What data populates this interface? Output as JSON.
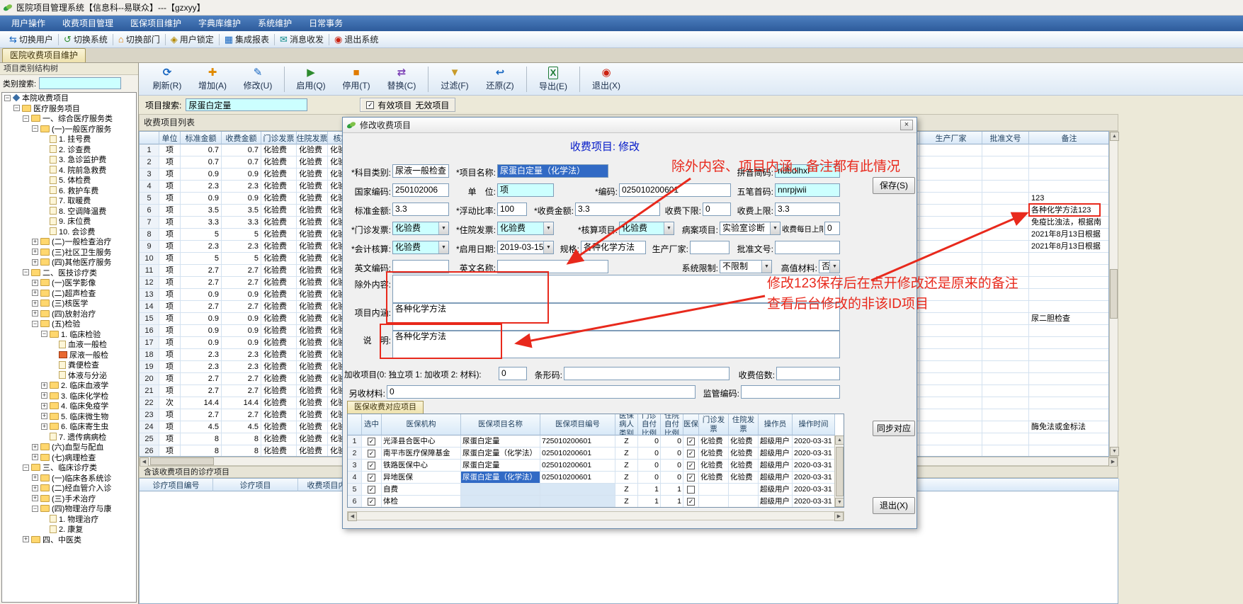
{
  "titlebar": {
    "title": "医院项目管理系统【信息科--易联众】---【gzxyy】"
  },
  "menubar": {
    "items": [
      "用户操作",
      "收费项目管理",
      "医保项目维护",
      "字典库维护",
      "系统维护",
      "日常事务"
    ]
  },
  "quickbar": {
    "items": [
      {
        "name": "switch-user",
        "label": "切换用户",
        "glyph": "⇆",
        "color": "#1565c0"
      },
      {
        "name": "switch-system",
        "label": "切换系统",
        "glyph": "↺",
        "color": "#2e8b2e"
      },
      {
        "name": "switch-dept",
        "label": "切换部门",
        "glyph": "⌂",
        "color": "#e07b00"
      },
      {
        "name": "user-lock",
        "label": "用户锁定",
        "glyph": "◈",
        "color": "#b58900"
      },
      {
        "name": "reports",
        "label": "集成报表",
        "glyph": "▦",
        "color": "#1565c0"
      },
      {
        "name": "messages",
        "label": "消息收发",
        "glyph": "✉",
        "color": "#0e8a8a"
      },
      {
        "name": "exit-system",
        "label": "退出系统",
        "glyph": "◉",
        "color": "#cc2211"
      }
    ]
  },
  "tab_strip": {
    "active_tab": "医院收费项目维护"
  },
  "left_panel": {
    "title": "项目类别结构树",
    "search_label": "类别搜索:",
    "search_value": "",
    "tree": [
      {
        "t": "本院收费项目",
        "i": 0,
        "y": "r",
        "e": "m"
      },
      {
        "t": "医疗服务项目",
        "i": 1,
        "y": "b",
        "e": "m"
      },
      {
        "t": "一、综合医疗服务类",
        "i": 2,
        "y": "b",
        "e": "m"
      },
      {
        "t": "(一)一般医疗服务",
        "i": 3,
        "y": "b",
        "e": "m"
      },
      {
        "t": "1. 挂号费",
        "i": 4,
        "y": "l",
        "e": "n"
      },
      {
        "t": "2. 诊查费",
        "i": 4,
        "y": "l",
        "e": "n"
      },
      {
        "t": "3. 急诊监护费",
        "i": 4,
        "y": "l",
        "e": "n"
      },
      {
        "t": "4. 院前急救费",
        "i": 4,
        "y": "l",
        "e": "n"
      },
      {
        "t": "5. 体检费",
        "i": 4,
        "y": "l",
        "e": "n"
      },
      {
        "t": "6. 救护车费",
        "i": 4,
        "y": "l",
        "e": "n"
      },
      {
        "t": "7. 取暖费",
        "i": 4,
        "y": "l",
        "e": "n"
      },
      {
        "t": "8. 空调降温费",
        "i": 4,
        "y": "l",
        "e": "n"
      },
      {
        "t": "9. 床位费",
        "i": 4,
        "y": "l",
        "e": "n"
      },
      {
        "t": "10. 会诊费",
        "i": 4,
        "y": "l",
        "e": "n"
      },
      {
        "t": "(二)一般检查治疗",
        "i": 3,
        "y": "b",
        "e": "p"
      },
      {
        "t": "(三)社区卫生服务",
        "i": 3,
        "y": "b",
        "e": "p"
      },
      {
        "t": "(四)其他医疗服务",
        "i": 3,
        "y": "b",
        "e": "p"
      },
      {
        "t": "二、医技诊疗类",
        "i": 2,
        "y": "b",
        "e": "m"
      },
      {
        "t": "(一)医学影像",
        "i": 3,
        "y": "b",
        "e": "p"
      },
      {
        "t": "(二)超声检查",
        "i": 3,
        "y": "b",
        "e": "p"
      },
      {
        "t": "(三)核医学",
        "i": 3,
        "y": "b",
        "e": "p"
      },
      {
        "t": "(四)放射治疗",
        "i": 3,
        "y": "b",
        "e": "p"
      },
      {
        "t": "(五)检验",
        "i": 3,
        "y": "b",
        "e": "m"
      },
      {
        "t": "1. 临床检验",
        "i": 4,
        "y": "b",
        "e": "m"
      },
      {
        "t": "血液一般检",
        "i": 5,
        "y": "l",
        "e": "n"
      },
      {
        "t": "尿液一般检",
        "i": 5,
        "y": "s",
        "e": "n",
        "sel": true
      },
      {
        "t": "粪便检查",
        "i": 5,
        "y": "l",
        "e": "n"
      },
      {
        "t": "体液与分泌",
        "i": 5,
        "y": "l",
        "e": "n"
      },
      {
        "t": "2. 临床血液学",
        "i": 4,
        "y": "b",
        "e": "p"
      },
      {
        "t": "3. 临床化学检",
        "i": 4,
        "y": "b",
        "e": "p"
      },
      {
        "t": "4. 临床免疫学",
        "i": 4,
        "y": "b",
        "e": "p"
      },
      {
        "t": "5. 临床微生物",
        "i": 4,
        "y": "b",
        "e": "p"
      },
      {
        "t": "6. 临床寄生虫",
        "i": 4,
        "y": "b",
        "e": "p"
      },
      {
        "t": "7. 遗传病病检",
        "i": 4,
        "y": "l",
        "e": "n"
      },
      {
        "t": "(六)血型与配血",
        "i": 3,
        "y": "b",
        "e": "p"
      },
      {
        "t": "(七)病理检查",
        "i": 3,
        "y": "b",
        "e": "p"
      },
      {
        "t": "三、临床诊疗类",
        "i": 2,
        "y": "b",
        "e": "m"
      },
      {
        "t": "(一)临床各系统诊",
        "i": 3,
        "y": "b",
        "e": "p"
      },
      {
        "t": "(二)经血管介入诊",
        "i": 3,
        "y": "b",
        "e": "p"
      },
      {
        "t": "(三)手术治疗",
        "i": 3,
        "y": "b",
        "e": "p"
      },
      {
        "t": "(四)物理治疗与康",
        "i": 3,
        "y": "b",
        "e": "m"
      },
      {
        "t": "1. 物理治疗",
        "i": 4,
        "y": "l",
        "e": "n"
      },
      {
        "t": "2. 康复",
        "i": 4,
        "y": "l",
        "e": "n"
      },
      {
        "t": "四、中医类",
        "i": 2,
        "y": "b",
        "e": "p"
      }
    ]
  },
  "toolbar": {
    "buttons": [
      {
        "name": "refresh",
        "label": "刷新(R)",
        "glyph": "⟳",
        "color": "#1565c0"
      },
      {
        "name": "add",
        "label": "增加(A)",
        "glyph": "✚",
        "color": "#e08a00"
      },
      {
        "name": "edit",
        "label": "修改(U)",
        "glyph": "✎",
        "color": "#1565c0",
        "sep": true
      },
      {
        "name": "enable",
        "label": "启用(Q)",
        "glyph": "▶",
        "color": "#2e8b2e"
      },
      {
        "name": "disable",
        "label": "停用(T)",
        "glyph": "■",
        "color": "#e07b00"
      },
      {
        "name": "replace",
        "label": "替换(C)",
        "glyph": "⇄",
        "color": "#7b3fb5",
        "sep": true
      },
      {
        "name": "filter",
        "label": "过滤(F)",
        "glyph": "▼",
        "color": "#c89b2a"
      },
      {
        "name": "restore",
        "label": "还原(Z)",
        "glyph": "↩",
        "color": "#1565c0",
        "sep": true
      },
      {
        "name": "export",
        "label": "导出(E)",
        "glyph": "X",
        "color": "#1c7a33",
        "sep": true,
        "excel": true
      },
      {
        "name": "exit",
        "label": "退出(X)",
        "glyph": "◉",
        "color": "#cc2211"
      }
    ]
  },
  "search_row": {
    "label": "项目搜索:",
    "value": "尿蛋白定量",
    "valid_label": "有效项目",
    "invalid_label": "无效项目",
    "valid_checked": true
  },
  "fee_list": {
    "title": "收费项目列表",
    "columns": [
      "",
      "单位",
      "标准金额",
      "收费金额",
      "门诊发票",
      "住院发票",
      "核算项目",
      "",
      "生产厂家",
      "批准文号",
      "备注"
    ],
    "rows": [
      [
        1,
        "项",
        "0.7",
        "0.7",
        "化验费",
        "化验费",
        "化验费",
        "",
        "",
        "",
        ""
      ],
      [
        2,
        "项",
        "0.7",
        "0.7",
        "化验费",
        "化验费",
        "化验费",
        "",
        "",
        "",
        ""
      ],
      [
        3,
        "项",
        "0.9",
        "0.9",
        "化验费",
        "化验费",
        "化验费",
        "",
        "",
        "",
        ""
      ],
      [
        4,
        "项",
        "2.3",
        "2.3",
        "化验费",
        "化验费",
        "化验费",
        "",
        "",
        "",
        ""
      ],
      [
        5,
        "项",
        "0.9",
        "0.9",
        "化验费",
        "化验费",
        "化验费",
        "",
        "",
        "",
        "123"
      ],
      [
        6,
        "项",
        "3.5",
        "3.5",
        "化验费",
        "化验费",
        "化验费",
        "",
        "",
        "",
        "各种化学方法123"
      ],
      [
        7,
        "项",
        "3.3",
        "3.3",
        "化验费",
        "化验费",
        "化验费",
        "",
        "",
        "",
        "免疫比浊法，根据南"
      ],
      [
        8,
        "项",
        "5",
        "5",
        "化验费",
        "化验费",
        "化验费",
        "",
        "",
        "",
        "2021年8月13日根据"
      ],
      [
        9,
        "项",
        "2.3",
        "2.3",
        "化验费",
        "化验费",
        "化验费",
        "",
        "",
        "",
        "2021年8月13日根据"
      ],
      [
        10,
        "项",
        "5",
        "5",
        "化验费",
        "化验费",
        "化验费",
        "",
        "",
        "",
        ""
      ],
      [
        11,
        "项",
        "2.7",
        "2.7",
        "化验费",
        "化验费",
        "化验费",
        "",
        "",
        "",
        ""
      ],
      [
        12,
        "项",
        "2.7",
        "2.7",
        "化验费",
        "化验费",
        "化验费",
        "",
        "",
        "",
        ""
      ],
      [
        13,
        "项",
        "0.9",
        "0.9",
        "化验费",
        "化验费",
        "化验费",
        "",
        "",
        "",
        ""
      ],
      [
        14,
        "项",
        "2.7",
        "2.7",
        "化验费",
        "化验费",
        "化验费",
        "",
        "",
        "",
        ""
      ],
      [
        15,
        "项",
        "0.9",
        "0.9",
        "化验费",
        "化验费",
        "化验费",
        "",
        "",
        "",
        "尿二胆检查"
      ],
      [
        16,
        "项",
        "0.9",
        "0.9",
        "化验费",
        "化验费",
        "化验费",
        "",
        "",
        "",
        ""
      ],
      [
        17,
        "项",
        "0.9",
        "0.9",
        "化验费",
        "化验费",
        "化验费",
        "",
        "",
        "",
        ""
      ],
      [
        18,
        "项",
        "2.3",
        "2.3",
        "化验费",
        "化验费",
        "化验费",
        "",
        "",
        "",
        ""
      ],
      [
        19,
        "项",
        "2.3",
        "2.3",
        "化验费",
        "化验费",
        "化验费",
        "",
        "",
        "",
        ""
      ],
      [
        20,
        "项",
        "2.7",
        "2.7",
        "化验费",
        "化验费",
        "化验费",
        "",
        "",
        "",
        ""
      ],
      [
        21,
        "项",
        "2.7",
        "2.7",
        "化验费",
        "化验费",
        "化验费",
        "",
        "",
        "",
        ""
      ],
      [
        22,
        "次",
        "14.4",
        "14.4",
        "化验费",
        "化验费",
        "化验费",
        "",
        "",
        "",
        ""
      ],
      [
        23,
        "项",
        "2.7",
        "2.7",
        "化验费",
        "化验费",
        "化验费",
        "",
        "",
        "",
        ""
      ],
      [
        24,
        "项",
        "4.5",
        "4.5",
        "化验费",
        "化验费",
        "化验费",
        "",
        "",
        "",
        "酶免法或金标法"
      ],
      [
        25,
        "项",
        "8",
        "8",
        "化验费",
        "化验费",
        "化验费",
        "",
        "",
        "",
        ""
      ],
      [
        26,
        "项",
        "8",
        "8",
        "化验费",
        "化验费",
        "化验费",
        "",
        "",
        "",
        ""
      ]
    ]
  },
  "bottom_panel": {
    "title": "含该收费项目的诊疗项目",
    "columns": [
      "诊疗项目编号",
      "诊疗项目",
      "收费项目内码",
      ""
    ]
  },
  "dialog": {
    "title": "修改收费项目",
    "close": "×",
    "header": "收费项目: 修改",
    "buttons": {
      "save": "保存(S)",
      "sync": "同步对应",
      "exit": "退出(X)"
    },
    "form": {
      "category": {
        "label": "*科目类别:",
        "value": "尿液一般检查"
      },
      "name": {
        "label": "*项目名称:",
        "value": "尿蛋白定量（化学法）"
      },
      "pinyin": {
        "label": "拼音简码:",
        "value": "ndbdlhxf"
      },
      "national_code": {
        "label": "国家编码:",
        "value": "250102006"
      },
      "unit": {
        "label": "单　位:",
        "value": "项"
      },
      "code": {
        "label": "*编码:",
        "value": "025010200601"
      },
      "wubi": {
        "label": "五笔首码:",
        "value": "nnrpjwii"
      },
      "std_amount": {
        "label": "标准金额:",
        "value": "3.3"
      },
      "float_ratio": {
        "label": "*浮动比率:",
        "value": "100"
      },
      "fee_amount": {
        "label": "*收费金额:",
        "value": "3.3"
      },
      "fee_lower": {
        "label": "收费下限:",
        "value": "0"
      },
      "fee_upper": {
        "label": "收费上限:",
        "value": "3.3"
      },
      "op_invoice": {
        "label": "*门诊发票:",
        "value": "化验费"
      },
      "ip_invoice": {
        "label": "*住院发票:",
        "value": "化验费"
      },
      "acct_item": {
        "label": "*核算项目:",
        "value": "化验费"
      },
      "case_item": {
        "label": "病案项目:",
        "value": "实验室诊断"
      },
      "daily_limit": {
        "label": "收费每日上限",
        "value": "0"
      },
      "fin_acct": {
        "label": "*会计核算:",
        "value": "化验费"
      },
      "enable_date": {
        "label": "*启用日期:",
        "value": "2019-03-15"
      },
      "spec": {
        "label": "规格:",
        "value": "各种化学方法"
      },
      "maker": {
        "label": "生产厂家:",
        "value": ""
      },
      "approval": {
        "label": "批准文号:",
        "value": ""
      },
      "en_code": {
        "label": "英文编码:",
        "value": ""
      },
      "en_name": {
        "label": "英文名称:",
        "value": ""
      },
      "sys_limit": {
        "label": "系统限制:",
        "value": "不限制"
      },
      "high_value": {
        "label": "高值材料:",
        "value": "否"
      },
      "exclusion": {
        "label": "除外内容:",
        "value": ""
      },
      "connotation": {
        "label": "项目内涵:",
        "value": "各种化学方法"
      },
      "note": {
        "label": "说　明:",
        "value": "各种化学方法"
      },
      "surcharge": {
        "label": "加收项目(0: 独立项 1: 加收项 2: 材料):",
        "value": "0"
      },
      "barcode": {
        "label": "条形码:",
        "value": ""
      },
      "fee_multiple": {
        "label": "收费倍数:",
        "value": ""
      },
      "extra_material": {
        "label": "另收材料:",
        "value": "0"
      },
      "regulator_code": {
        "label": "监管编码:",
        "value": ""
      }
    },
    "insurance_tab": "医保收费对应项目",
    "insurance_table": {
      "columns": [
        "",
        "选中",
        "医保机构",
        "医保项目名称",
        "医保项目编号",
        "医保病人类别",
        "门诊自付比例",
        "住院自付比例",
        "医保",
        "门诊发票",
        "住院发票",
        "操作员",
        "操作时间"
      ],
      "rows": [
        [
          1,
          true,
          "光泽县合医中心",
          "尿蛋白定量",
          "725010200601",
          "Z",
          "0",
          "0",
          true,
          "化验费",
          "化验费",
          "超级用户",
          "2020-03-31"
        ],
        [
          2,
          true,
          "南平市医疗保障基金",
          "尿蛋白定量（化学法）",
          "025010200601",
          "Z",
          "0",
          "0",
          true,
          "化验费",
          "化验费",
          "超级用户",
          "2020-03-31"
        ],
        [
          3,
          true,
          "铁路医保中心",
          "尿蛋白定量",
          "025010200601",
          "Z",
          "0",
          "0",
          true,
          "化验费",
          "化验费",
          "超级用户",
          "2020-03-31"
        ],
        [
          4,
          true,
          "异地医保",
          "尿蛋白定量（化学法）",
          "025010200601",
          "Z",
          "0",
          "0",
          true,
          "化验费",
          "化验费",
          "超级用户",
          "2020-03-31"
        ],
        [
          5,
          true,
          "自费",
          "",
          "",
          "Z",
          "1",
          "1",
          false,
          "",
          "",
          "超级用户",
          "2020-03-31"
        ],
        [
          6,
          true,
          "体检",
          "",
          "",
          "Z",
          "1",
          "1",
          true,
          "",
          "",
          "超级用户",
          "2020-03-31"
        ]
      ]
    }
  },
  "annotations": {
    "note1": "除外内容、项目内涵、备注都有此情况",
    "note2a": "修改123保存后在点开修改还是原来的备注",
    "note2b": "查看后台修改的非该ID项目",
    "color": "#e8291c"
  }
}
